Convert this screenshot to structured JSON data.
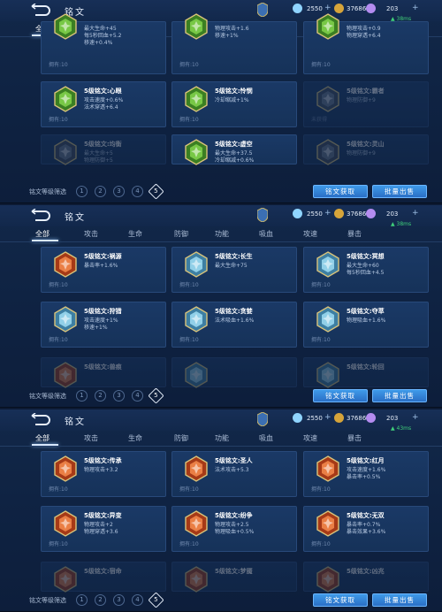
{
  "header": {
    "title": "铭文",
    "resources": {
      "diamonds": "2550",
      "coins": "37686",
      "crystals": "203"
    },
    "plus": "+",
    "net": {
      "wifi_icon": "wifi-icon",
      "latencies": [
        "38ms",
        "38ms",
        "43ms"
      ]
    }
  },
  "tabs": [
    "全部",
    "攻击",
    "生命",
    "防御",
    "功能",
    "吸血",
    "攻速",
    "暴击"
  ],
  "filter": {
    "label": "铭文等级筛选",
    "levels": [
      "1",
      "2",
      "3",
      "4",
      "5"
    ],
    "selected": "5"
  },
  "buttons": {
    "get": "铭文获取",
    "sell": "批量出售"
  },
  "colors": {
    "accent_blue": "#3f9ae8",
    "panel_bg": "#0f2343",
    "green_gem": "#62b83a",
    "teal_gem": "#5fa7c9",
    "orange_gem": "#d8612a"
  },
  "panels": [
    {
      "cards": [
        {
          "name": "",
          "stats": [
            "最大生命+45",
            "每5秒回血+5.2",
            "移速+0.4%"
          ],
          "owned": "拥有:10",
          "gem": "green"
        },
        {
          "name": "",
          "stats": [
            "物理攻击+1.6",
            "移速+1%"
          ],
          "owned": "拥有:10",
          "gem": "green"
        },
        {
          "name": "",
          "stats": [
            "物理攻击+0.9",
            "物理穿透+6.4"
          ],
          "owned": "拥有:10",
          "gem": "green"
        },
        {
          "name": "5级铭文:心眼",
          "stats": [
            "攻击速度+0.6%",
            "法术穿透+6.4"
          ],
          "owned": "拥有:10",
          "gem": "green"
        },
        {
          "name": "5级铭文:怜悯",
          "stats": [
            "冷却缩减+1%"
          ],
          "owned": "拥有:10",
          "gem": "green"
        },
        {
          "name": "5级铭文:霸者",
          "stats": [
            "物理防御+9"
          ],
          "owned": "未获得",
          "gem": "grey"
        },
        {
          "name": "5级铭文:均衡",
          "stats": [
            "最大生命+5",
            "物理防御+5"
          ],
          "owned": "",
          "gem": "grey"
        },
        {
          "name": "5级铭文:虚空",
          "stats": [
            "最大生命+37.5",
            "冷却缩减+0.6%"
          ],
          "owned": "",
          "gem": "green"
        },
        {
          "name": "5级铭文:灵山",
          "stats": [
            "物理防御+9"
          ],
          "owned": "",
          "gem": "grey"
        }
      ]
    },
    {
      "cards": [
        {
          "name": "5级铭文:祸源",
          "stats": [
            "暴击率+1.6%"
          ],
          "owned": "拥有:10",
          "gem": "orange"
        },
        {
          "name": "5级铭文:长生",
          "stats": [
            "最大生命+75"
          ],
          "owned": "拥有:10",
          "gem": "teal"
        },
        {
          "name": "5级铭文:冥想",
          "stats": [
            "最大生命+60",
            "每5秒回血+4.5"
          ],
          "owned": "拥有:10",
          "gem": "teal"
        },
        {
          "name": "5级铭文:狩猎",
          "stats": [
            "攻击速度+1%",
            "移速+1%"
          ],
          "owned": "拥有:10",
          "gem": "teal"
        },
        {
          "name": "5级铭文:贪婪",
          "stats": [
            "法术吸血+1.6%"
          ],
          "owned": "拥有:10",
          "gem": "teal"
        },
        {
          "name": "5级铭文:夺萃",
          "stats": [
            "物理吸血+1.6%"
          ],
          "owned": "拥有:10",
          "gem": "teal"
        },
        {
          "name": "5级铭文:兽痕",
          "stats": [],
          "owned": "",
          "gem": "orange"
        },
        {
          "name": "",
          "stats": [],
          "owned": "",
          "gem": "teal"
        },
        {
          "name": "5级铭文:轮回",
          "stats": [],
          "owned": "",
          "gem": "teal"
        }
      ]
    },
    {
      "cards": [
        {
          "name": "5级铭文:传承",
          "stats": [
            "物理攻击+3.2"
          ],
          "owned": "拥有:10",
          "gem": "orange"
        },
        {
          "name": "5级铭文:圣人",
          "stats": [
            "法术攻击+5.3"
          ],
          "owned": "拥有:10",
          "gem": "orange"
        },
        {
          "name": "5级铭文:红月",
          "stats": [
            "攻击速度+1.6%",
            "暴击率+0.5%"
          ],
          "owned": "拥有:10",
          "gem": "orange"
        },
        {
          "name": "5级铭文:异变",
          "stats": [
            "物理攻击+2",
            "物理穿透+3.6"
          ],
          "owned": "拥有:10",
          "gem": "orange"
        },
        {
          "name": "5级铭文:纷争",
          "stats": [
            "物理攻击+2.5",
            "物理吸血+0.5%"
          ],
          "owned": "拥有:10",
          "gem": "orange"
        },
        {
          "name": "5级铭文:无双",
          "stats": [
            "暴击率+0.7%",
            "暴击效果+3.6%"
          ],
          "owned": "拥有:10",
          "gem": "orange"
        },
        {
          "name": "5级铭文:宿命",
          "stats": [],
          "owned": "",
          "gem": "orange"
        },
        {
          "name": "5级铭文:梦魇",
          "stats": [],
          "owned": "",
          "gem": "orange"
        },
        {
          "name": "5级铭文:凶兆",
          "stats": [],
          "owned": "",
          "gem": "orange"
        }
      ]
    }
  ]
}
